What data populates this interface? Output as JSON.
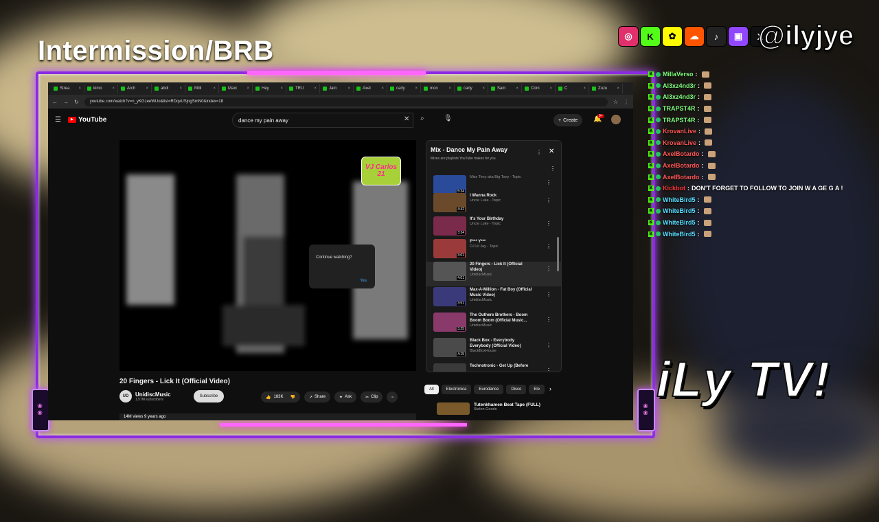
{
  "overlay": {
    "title": "Intermission/BRB",
    "handle": "@ilyjye",
    "brand": "iLy TV!",
    "socials": [
      {
        "icon": "instagram-icon",
        "glyph": "◎",
        "color": "#e1306c"
      },
      {
        "icon": "kick-icon",
        "glyph": "K",
        "color": "#53fc18"
      },
      {
        "icon": "snapchat-icon",
        "glyph": "✿",
        "color": "#fffc00"
      },
      {
        "icon": "soundcloud-icon",
        "glyph": "☁",
        "color": "#ff5500"
      },
      {
        "icon": "tiktok-icon",
        "glyph": "♪",
        "color": "#222222"
      },
      {
        "icon": "twitch-icon",
        "glyph": "▣",
        "color": "#9146ff"
      },
      {
        "icon": "x-icon",
        "glyph": "X",
        "color": "#111111"
      }
    ]
  },
  "browser": {
    "tabs": [
      "Strea",
      "kimo",
      "Arch",
      "abdi",
      "Milli",
      "Maxi",
      "Hey",
      "TRU",
      "Jam",
      "Axel",
      "carly",
      "mon",
      "carly",
      "Sam",
      "Com",
      "C",
      "Zuzu"
    ],
    "url": "youtube.com/watch?v=n_yKGzeeWUo&list=RDqvUSjngSmN0&index=18"
  },
  "youtube": {
    "logo": "YouTube",
    "search_value": "dance my pain away",
    "create_label": "Create",
    "notif_badge": "9+",
    "video_title": "20 Fingers - Lick It (Official Video)",
    "watermark": "VJ Carlos 21",
    "dialog": {
      "text": "Continue watching?",
      "button": "Yes"
    },
    "channel": {
      "name": "UnidiscMusic",
      "subs": "1.57M subscribers",
      "avatar": "UD"
    },
    "subscribe_label": "Subscribe",
    "actions": {
      "likes": "183K",
      "share": "Share",
      "ask": "Ask",
      "clip": "Clip"
    },
    "meta": "14M views  9 years ago"
  },
  "mix": {
    "title": "Mix - Dance My Pain Away",
    "subtitle": "Mixes are playlists YouTube makes for you",
    "items": [
      {
        "title": "",
        "channel": "Miss Tony aka Big Tony - Topic",
        "duration": "5:34",
        "color": "#2a4a9a"
      },
      {
        "title": "I Wanna Rock",
        "channel": "Uncle Luke - Topic",
        "duration": "4:42",
        "color": "#6a4a2a"
      },
      {
        "title": "It's Your Birthday",
        "channel": "Uncle Luke - Topic",
        "duration": "3:34",
        "color": "#7a2a4a"
      },
      {
        "title": "F*** Y***",
        "channel": "DJ Lil Jay - Topic",
        "duration": "3:01",
        "color": "#9a3a3a"
      },
      {
        "title": "20 Fingers - Lick It (Official Video)",
        "channel": "UnidiscMusic",
        "duration": "4:01",
        "color": "#555555"
      },
      {
        "title": "Max-A-Million - Fat Boy (Official Music Video)",
        "channel": "UnidiscMusic",
        "duration": "3:51",
        "color": "#3a3a7a"
      },
      {
        "title": "The Outhere Brothers - Boom Boom Boom (Official Music...",
        "channel": "UnidiscMusic",
        "duration": "3:25",
        "color": "#8a3a6a"
      },
      {
        "title": "Black Box - Everybody Everybody (Official Video)",
        "channel": "BlackBoxHouse",
        "duration": "4:15",
        "color": "#4a4a4a"
      },
      {
        "title": "Technotronic - Get Up (Before",
        "channel": "",
        "duration": "",
        "color": "#3a3a3a"
      }
    ],
    "chips": [
      "All",
      "Electronica",
      "Eurodance",
      "Disco",
      "Ele"
    ],
    "next_video": {
      "title": "Tutenkhamen Beat Tape (FULL)",
      "channel": "Stolen Goods"
    }
  },
  "chat": [
    {
      "user": "MillaVerso",
      "color": "#7fff7f",
      "msg": ""
    },
    {
      "user": "Al3xz4nd3r",
      "color": "#7fff7f",
      "msg": ""
    },
    {
      "user": "Al3xz4nd3r",
      "color": "#7fff7f",
      "msg": ""
    },
    {
      "user": "TRAPST4R",
      "color": "#7fff7f",
      "msg": ""
    },
    {
      "user": "TRAPST4R",
      "color": "#7fff7f",
      "msg": ""
    },
    {
      "user": "KrovanLive",
      "color": "#ff5555",
      "msg": ""
    },
    {
      "user": "KrovanLive",
      "color": "#ff5555",
      "msg": ""
    },
    {
      "user": "AxelBotardo",
      "color": "#ff5555",
      "msg": ""
    },
    {
      "user": "AxelBotardo",
      "color": "#ff5555",
      "msg": ""
    },
    {
      "user": "AxelBotardo",
      "color": "#ff5555",
      "msg": ""
    },
    {
      "user": "Kickbot",
      "color": "#ff3333",
      "msg": "DON'T FORGET TO FOLLOW TO JOIN W A GE G A !"
    },
    {
      "user": "WhiteBird5",
      "color": "#55ddff",
      "msg": ""
    },
    {
      "user": "WhiteBird5",
      "color": "#55ddff",
      "msg": ""
    },
    {
      "user": "WhiteBird5",
      "color": "#55ddff",
      "msg": ""
    },
    {
      "user": "WhiteBird5",
      "color": "#55ddff",
      "msg": ""
    }
  ]
}
